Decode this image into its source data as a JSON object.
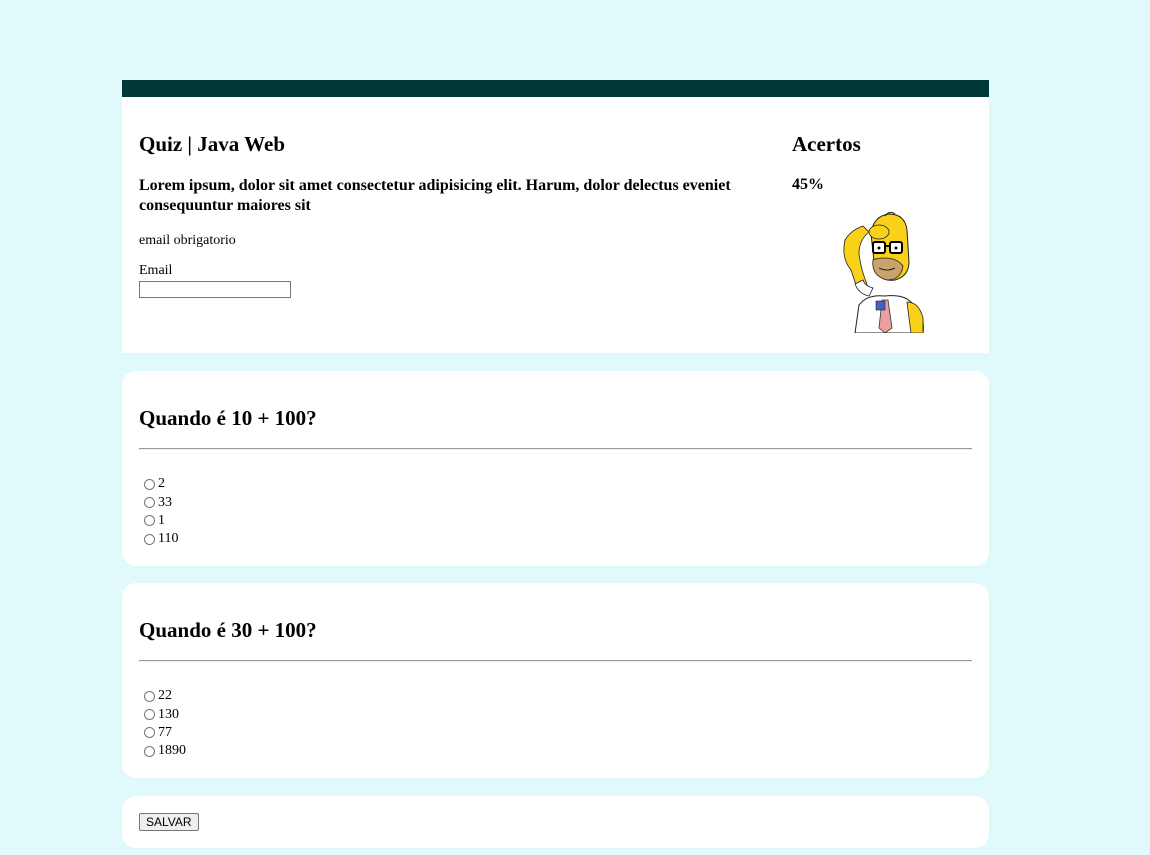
{
  "header": {
    "title": "Quiz | Java Web",
    "description": "Lorem ipsum, dolor sit amet consectetur adipisicing elit. Harum, dolor delectus eveniet consequuntur maiores sit",
    "required_notice": "email obrigatorio",
    "email_label": "Email",
    "email_value": "",
    "email_placeholder": ""
  },
  "score": {
    "title": "Acertos",
    "value": "45%",
    "image": "homer-scratching-head-icon"
  },
  "questions": [
    {
      "title": "Quando é 10 + 100?",
      "options": [
        "2",
        "33",
        "1",
        "110"
      ]
    },
    {
      "title": "Quando é 30 + 100?",
      "options": [
        "22",
        "130",
        "77",
        "1890"
      ]
    }
  ],
  "actions": {
    "save_label": "SALVAR"
  },
  "colors": {
    "page_background": "#e0f9fa",
    "header_bar": "#003838",
    "card_background": "#ffffff"
  }
}
